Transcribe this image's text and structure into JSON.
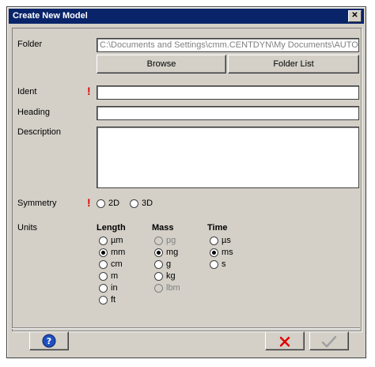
{
  "window": {
    "title": "Create New Model"
  },
  "folder": {
    "label": "Folder",
    "path": "C:\\Documents and Settings\\cmm.CENTDYN\\My Documents\\AUTOD",
    "browse_label": "Browse",
    "folder_list_label": "Folder List"
  },
  "ident": {
    "label": "Ident",
    "value": ""
  },
  "heading": {
    "label": "Heading",
    "value": ""
  },
  "description": {
    "label": "Description",
    "value": ""
  },
  "symmetry": {
    "label": "Symmetry",
    "options": [
      "2D",
      "3D"
    ],
    "selected": ""
  },
  "units": {
    "label": "Units",
    "length": {
      "title": "Length",
      "options": [
        "µm",
        "mm",
        "cm",
        "m",
        "in",
        "ft"
      ],
      "selected": "mm"
    },
    "mass": {
      "title": "Mass",
      "options": [
        "pg",
        "mg",
        "g",
        "kg",
        "lbm"
      ],
      "selected": "mg",
      "disabled": [
        "pg",
        "lbm"
      ]
    },
    "time": {
      "title": "Time",
      "options": [
        "µs",
        "ms",
        "s"
      ],
      "selected": "ms"
    }
  },
  "icons": {
    "help": "help-icon",
    "cancel": "cancel-x-icon",
    "ok": "checkmark-icon",
    "close": "close-icon"
  },
  "colors": {
    "title_bar": "#0a246a",
    "required": "#e00000",
    "face": "#d4d0c8"
  }
}
